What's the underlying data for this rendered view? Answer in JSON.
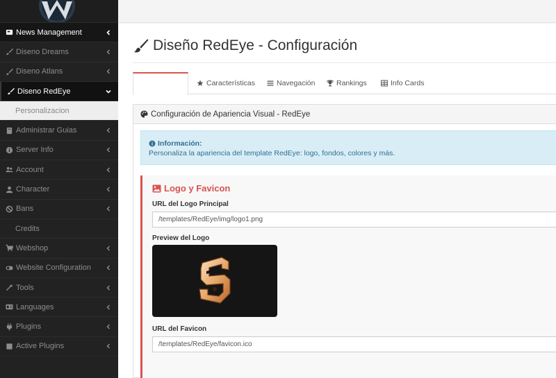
{
  "sidebar": {
    "items": [
      {
        "label": "News Management",
        "icon": "newspaper-icon"
      },
      {
        "label": "Diseno Dreams",
        "icon": "brush-icon"
      },
      {
        "label": "Diseno Atlans",
        "icon": "brush-icon"
      },
      {
        "label": "Diseno RedEye",
        "icon": "brush-icon"
      },
      {
        "label": "Personalizacion"
      },
      {
        "label": "Administrar Guias",
        "icon": "book-icon"
      },
      {
        "label": "Server Info",
        "icon": "info-circle-icon"
      },
      {
        "label": "Account",
        "icon": "users-icon"
      },
      {
        "label": "Character",
        "icon": "user-icon"
      },
      {
        "label": "Bans",
        "icon": "ban-icon"
      },
      {
        "label": "Credits"
      },
      {
        "label": "Webshop",
        "icon": "cart-icon"
      },
      {
        "label": "Website Configuration",
        "icon": "toggle-icon"
      },
      {
        "label": "Tools",
        "icon": "wrench-icon"
      },
      {
        "label": "Languages",
        "icon": "language-icon"
      },
      {
        "label": "Plugins",
        "icon": "plug-icon"
      },
      {
        "label": "Active Plugins",
        "icon": "square-icon"
      }
    ]
  },
  "main": {
    "title": "Diseño RedEye - Configuración",
    "tabs": [
      {
        "label": "",
        "active": true
      },
      {
        "label": "Características",
        "icon": "star-icon"
      },
      {
        "label": "Navegación",
        "icon": "bars-icon"
      },
      {
        "label": "Rankings",
        "icon": "trophy-icon"
      },
      {
        "label": "Info Cards",
        "icon": "table-icon"
      }
    ],
    "panel": {
      "title": "Configuración de Apariencia Visual - RedEye",
      "info_title": "Información:",
      "info_text": "Personaliza la apariencia del template RedEye: logo, fondos, colores y más.",
      "section_title": "Logo y Favicon",
      "logo_label": "URL del Logo Principal",
      "logo_value": "/templates/RedEye/img/logo1.png",
      "preview_label": "Preview del Logo",
      "favicon_label": "URL del Favicon",
      "favicon_value": "/templates/RedEye/favicon.ico"
    }
  },
  "colors": {
    "accent": "#d9534f",
    "sidebar_bg": "#222222",
    "info_bg": "#d9edf7",
    "info_text": "#31708f"
  }
}
